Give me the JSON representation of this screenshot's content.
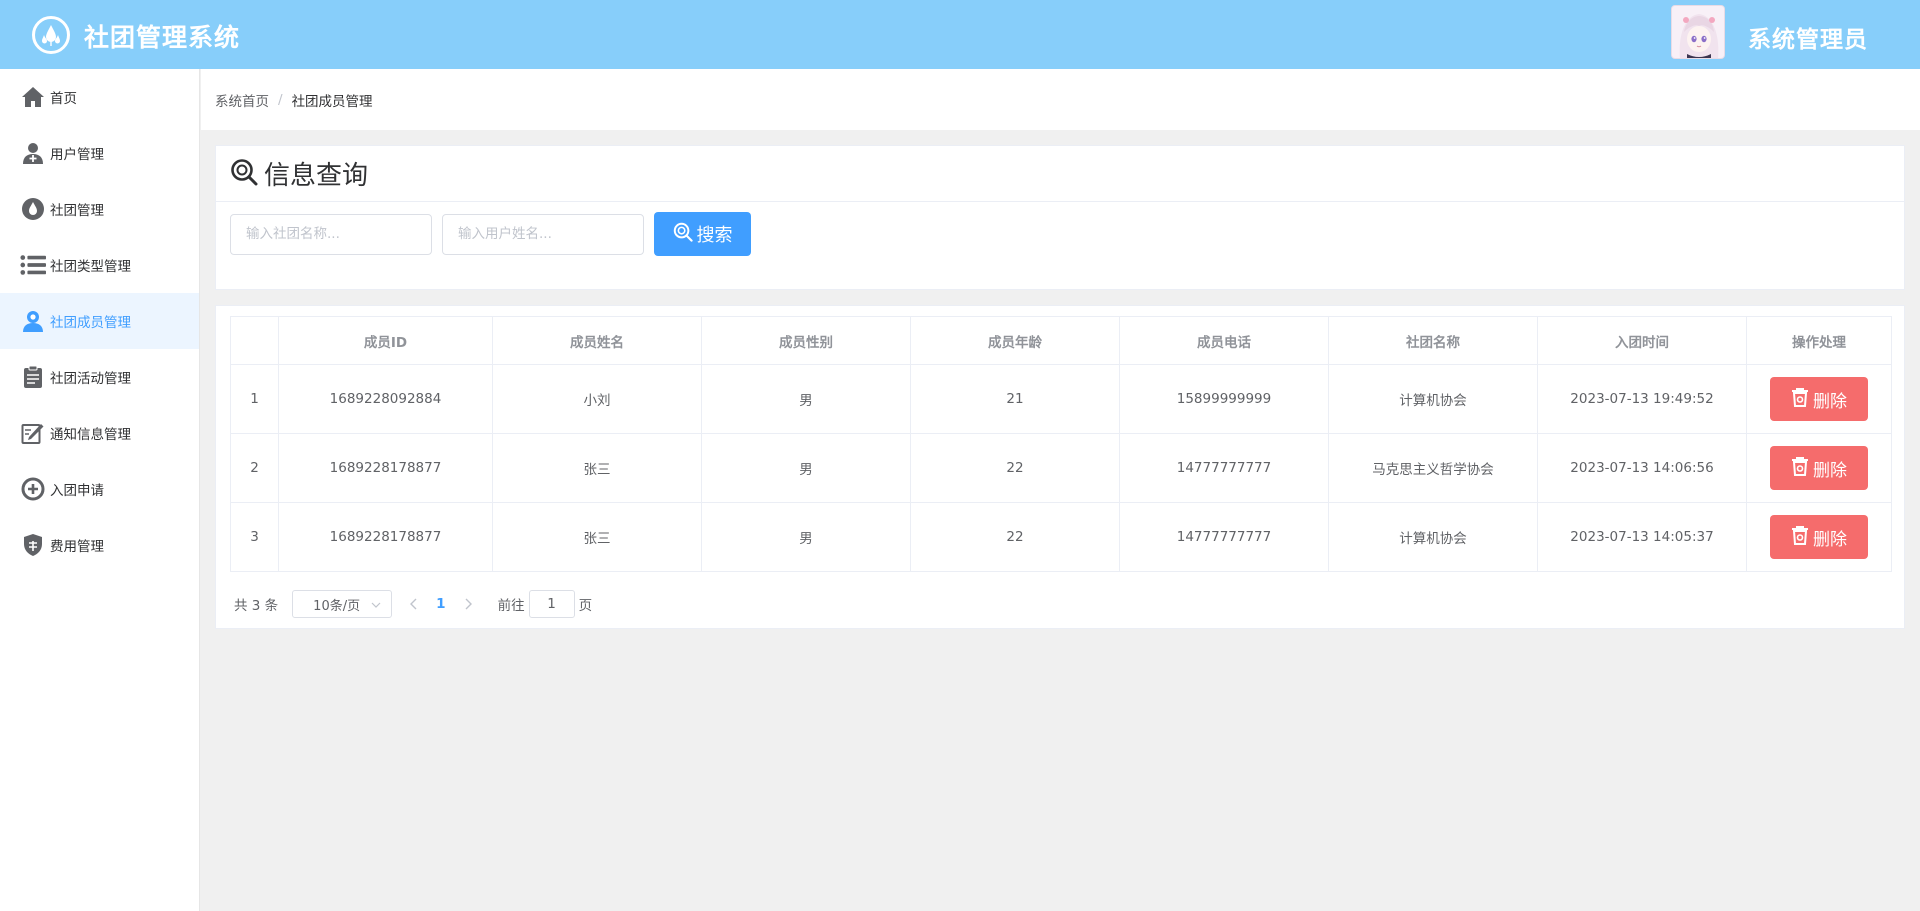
{
  "header": {
    "app_title": "社团管理系统",
    "user_name": "系统管理员",
    "bg_color": "#87cefa"
  },
  "sidebar": {
    "items": [
      {
        "label": "首页",
        "icon": "home-icon"
      },
      {
        "label": "用户管理",
        "icon": "user-add-icon"
      },
      {
        "label": "社团管理",
        "icon": "drop-icon"
      },
      {
        "label": "社团类型管理",
        "icon": "list-icon"
      },
      {
        "label": "社团成员管理",
        "icon": "member-icon",
        "active": true
      },
      {
        "label": "社团活动管理",
        "icon": "clipboard-icon"
      },
      {
        "label": "通知信息管理",
        "icon": "edit-icon"
      },
      {
        "label": "入团申请",
        "icon": "plus-circle-icon"
      },
      {
        "label": "费用管理",
        "icon": "shield-icon"
      }
    ]
  },
  "breadcrumb": {
    "home": "系统首页",
    "separator": "/",
    "current": "社团成员管理"
  },
  "query": {
    "title": "信息查询",
    "club_placeholder": "输入社团名称...",
    "user_placeholder": "输入用户姓名...",
    "search_label": "搜索"
  },
  "table": {
    "headers": [
      "",
      "成员ID",
      "成员姓名",
      "成员性别",
      "成员年龄",
      "成员电话",
      "社团名称",
      "入团时间",
      "操作处理"
    ],
    "rows": [
      {
        "index": "1",
        "id": "1689228092884",
        "name": "小刘",
        "gender": "男",
        "age": "21",
        "phone": "15899999999",
        "club": "计算机协会",
        "join_time": "2023-07-13 19:49:52",
        "action": "删除"
      },
      {
        "index": "2",
        "id": "1689228178877",
        "name": "张三",
        "gender": "男",
        "age": "22",
        "phone": "14777777777",
        "club": "马克思主义哲学协会",
        "join_time": "2023-07-13 14:06:56",
        "action": "删除"
      },
      {
        "index": "3",
        "id": "1689228178877",
        "name": "张三",
        "gender": "男",
        "age": "22",
        "phone": "14777777777",
        "club": "计算机协会",
        "join_time": "2023-07-13 14:05:37",
        "action": "删除"
      }
    ]
  },
  "pagination": {
    "total": "共 3 条",
    "page_size": "10条/页",
    "current_page": "1",
    "goto_prefix": "前往",
    "goto_value": "1",
    "goto_suffix": "页"
  },
  "colors": {
    "primary": "#409eff",
    "danger": "#f56c6c",
    "active_bg": "#ecf5ff"
  }
}
